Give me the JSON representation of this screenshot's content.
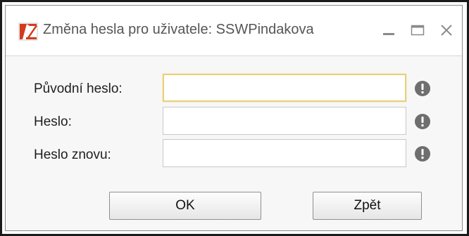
{
  "window": {
    "title": "Změna hesla pro uživatele: SSWPindakova",
    "logo_icon": "app-logo-icon",
    "controls": [
      "minimize-icon",
      "maximize-icon",
      "close-icon"
    ]
  },
  "form": {
    "original_password_label": "Původní heslo:",
    "original_password_value": "",
    "password_label": "Heslo:",
    "password_value": "",
    "password_again_label": "Heslo znovu:",
    "password_again_value": "",
    "validation_icon": "exclamation-icon"
  },
  "buttons": {
    "ok_label": "OK",
    "back_label": "Zpět"
  },
  "colors": {
    "focus_border": "#e8cf7a",
    "warning_icon": "#6e6e6e",
    "logo_red": "#d43a1e"
  }
}
